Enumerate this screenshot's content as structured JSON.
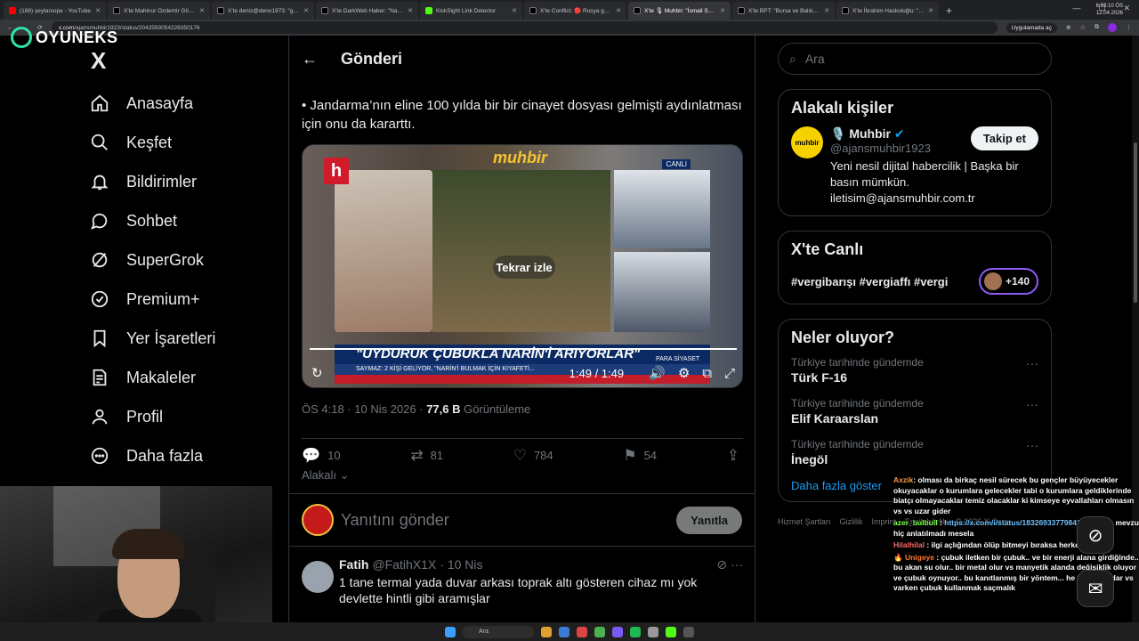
{
  "browser": {
    "tabs": [
      {
        "label": "(188) şeytanıope - YouTube",
        "fav": "yt"
      },
      {
        "label": "X'te Mahinur Özdemir Göktaş",
        "fav": "x"
      },
      {
        "label": "X'te deniz@deno1973: \"gorevin",
        "fav": "x"
      },
      {
        "label": "X'te DarkWeb Haber: \"Narin Gü",
        "fav": "x"
      },
      {
        "label": "KickSight Link Detector",
        "fav": "k"
      },
      {
        "label": "X'te Conflict: 🔴 Rusya geliştir",
        "fav": "x"
      },
      {
        "label": "X'te 🎙 Muhbir: \"İsmail Saymaz",
        "fav": "x",
        "active": true
      },
      {
        "label": "X'te BPT: \"Bursa ve Balıkesir'de",
        "fav": "x"
      },
      {
        "label": "X'te İbrahim Haskoloğlu: \"🔴 Fl",
        "fav": "x"
      }
    ],
    "url_host": "x.com",
    "url_path": "/ajansmuhbir1923/status/2042593054226350176",
    "app_button": "Uygulamada aç"
  },
  "overlay_logo": "OYUNEKS",
  "nav": {
    "logo": "X",
    "items": [
      {
        "label": "Anasayfa",
        "icon": "home-icon"
      },
      {
        "label": "Keşfet",
        "icon": "search-icon"
      },
      {
        "label": "Bildirimler",
        "icon": "bell-icon"
      },
      {
        "label": "Sohbet",
        "icon": "chat-icon"
      },
      {
        "label": "SuperGrok",
        "icon": "grok-icon"
      },
      {
        "label": "Premium+",
        "icon": "verified-icon"
      },
      {
        "label": "Yer İşaretleri",
        "icon": "bookmark-icon"
      },
      {
        "label": "Makaleler",
        "icon": "article-icon"
      },
      {
        "label": "Profil",
        "icon": "person-icon"
      },
      {
        "label": "Daha fazla",
        "icon": "more-circle-icon"
      }
    ]
  },
  "post": {
    "header": "Gönderi",
    "text": "• Jandarma’nın eline 100 yılda bir bir cinayet dosyası gelmişti aydınlatması için onu da kararttı.",
    "video": {
      "replay_label": "Tekrar izle",
      "time": "1:49 / 1:49",
      "progress": 1.0,
      "channel_logo": "muhbir",
      "live_tag": "CANLI",
      "banner": "\"UYDURUK ÇUBUKLA NARİN'İ ARIYORLAR\"",
      "subtitle": "SAYMAZ: 2 KİŞİ GELİYOR, \"NARİN'İ BULMAK İÇİN KIYAFETİ...",
      "tag": "PARA SİYASET"
    },
    "meta_time": "ÖS 4:18 · 10 Nis 2026 · ",
    "meta_views": "77,6 B",
    "meta_views_label": " Görüntüleme",
    "stats": {
      "replies": "10",
      "reposts": "81",
      "likes": "784",
      "bookmarks": "54"
    },
    "related_label": "Alakalı",
    "reply_placeholder": "Yanıtını gönder",
    "reply_button": "Yanıtla"
  },
  "comment": {
    "name": "Fatih",
    "handle": "@FatihX1X",
    "date": "· 10 Nis",
    "text": "1 tane termal yada duvar arkası toprak altı gösteren cihaz mı yok devlette hintli gibi aramışlar"
  },
  "right": {
    "search_placeholder": "Ara",
    "related_title": "Alakalı kişiler",
    "person": {
      "name": "🎙️ Muhbir",
      "handle": "@ajansmuhbir1923",
      "avatar_text": "muhbir",
      "bio": "Yeni nesil dijital habercilik | Başka bir basın mümkün. iletisim@ajansmuhbir.com.tr",
      "follow": "Takip et"
    },
    "live_title": "X'te Canlı",
    "live_tags": "#vergibarışı #vergiaffı #vergi",
    "live_count": "+140",
    "trends_title": "Neler oluyor?",
    "trends": [
      {
        "category": "Türkiye tarihinde gündemde",
        "name": "Türk F-16"
      },
      {
        "category": "Türkiye tarihinde gündemde",
        "name": "Elif Karaarslan"
      },
      {
        "category": "Türkiye tarihinde gündemde",
        "name": "İnegöl"
      }
    ],
    "show_more": "Daha fazla göster",
    "footer": [
      "Hizmet Şartları",
      "Gizlilik",
      "Imprint",
      "Erişilebilirlik",
      "© 2026 X Corp."
    ]
  },
  "chat": [
    {
      "user": "Axzik",
      "cls": "u1",
      "text": ": olması da birkaç nesil sürecek bu gençler büyüyecekler okuyacaklar o kurumlara gelecekler tabi o kurumlara geldiklerinde biatçı olmayacaklar temiz olacaklar ki kimseye eyvallahları olmasın vs vs uzar gider"
    },
    {
      "user": "azer_bulbull",
      "cls": "u2",
      "text": " : ",
      "link": "https://x.com/i/status/1832693377984108437",
      "after": " bu mevzu hiç anlatılmadı mesela"
    },
    {
      "user": "Hilalhilal",
      "cls": "u3",
      "text": " : ilgi açlığından ölüp bitmeyi bıraksa herkes"
    },
    {
      "user": "🔥 Unigeye",
      "cls": "u4",
      "text": " : çubuk iletken bir çubuk.. ve bir enerji alana girdiğinde.. bu akan su olur.. bir metal olur vs manyetik alanda değişiklik oluyor ve çubuk oynuyor.. bu kanıtlanmış bir yöntem... he 2024 de lidar vs varken çubuk kullanmak saçmalık"
    }
  ],
  "taskbar": {
    "search": "Ara",
    "time": "6:59:10 ÖS",
    "date": "12.04.2026"
  }
}
